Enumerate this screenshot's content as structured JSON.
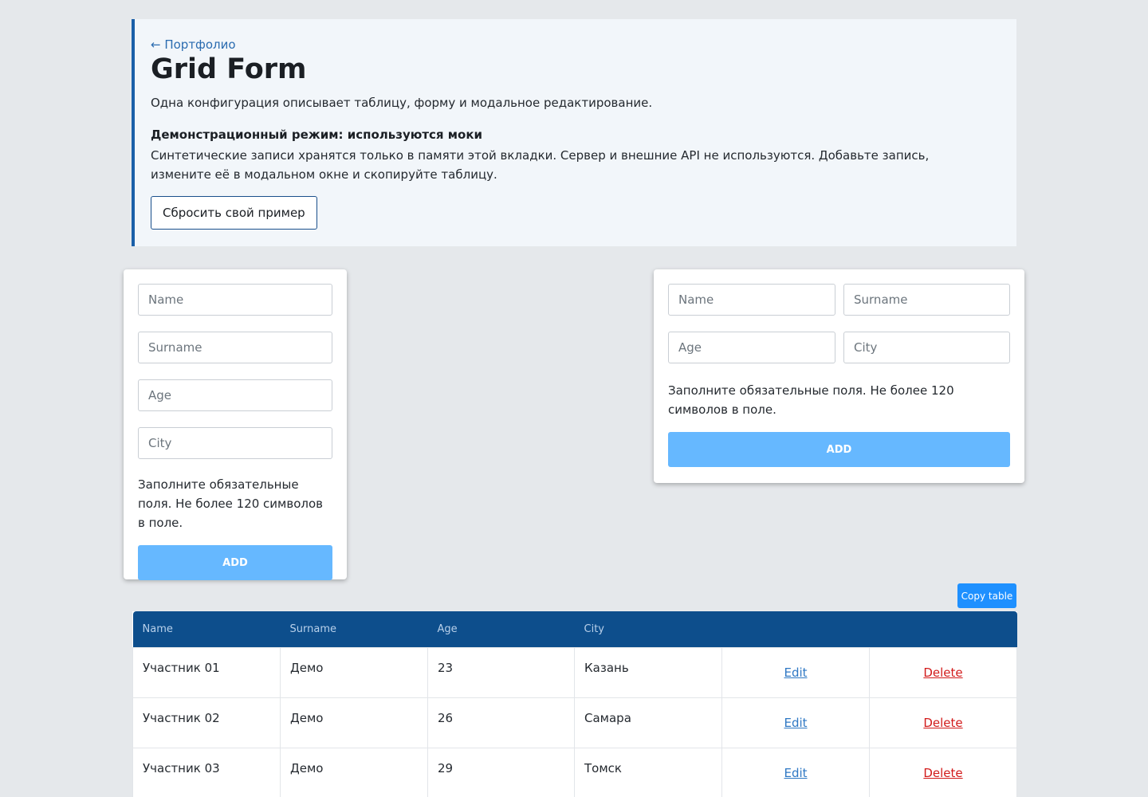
{
  "header": {
    "back_link": "← Портфолио",
    "title": "Grid Form",
    "description": "Одна конфигурация описывает таблицу, форму и модальное редактирование.",
    "demo_title": "Демонстрационный режим: используются моки",
    "demo_description": "Синтетические записи хранятся только в памяти этой вкладки. Сервер и внешние API не используются. Добавьте запись, измените её в модальном окне и скопируйте таблицу.",
    "reset_button": "Сбросить свой пример"
  },
  "form_vertical": {
    "name_placeholder": "Name",
    "surname_placeholder": "Surname",
    "age_placeholder": "Age",
    "city_placeholder": "City",
    "hint": "Заполните обязательные поля. Не более 120 символов в поле.",
    "add_button": "ADD"
  },
  "form_grid": {
    "name_placeholder": "Name",
    "surname_placeholder": "Surname",
    "age_placeholder": "Age",
    "city_placeholder": "City",
    "hint": "Заполните обязательные поля. Не более 120 символов в поле.",
    "add_button": "ADD"
  },
  "copy_button": "Copy table",
  "table": {
    "columns": [
      "Name",
      "Surname",
      "Age",
      "City"
    ],
    "rows": [
      {
        "name": "Участник 01",
        "surname": "Демо",
        "age": "23",
        "city": "Казань",
        "edit": "Edit",
        "delete": "Delete"
      },
      {
        "name": "Участник 02",
        "surname": "Демо",
        "age": "26",
        "city": "Самара",
        "edit": "Edit",
        "delete": "Delete"
      },
      {
        "name": "Участник 03",
        "surname": "Демо",
        "age": "29",
        "city": "Томск",
        "edit": "Edit",
        "delete": "Delete"
      }
    ]
  },
  "colors": {
    "background": "#e5e8eb",
    "panel_background": "#f2f6fa",
    "panel_accent": "#1a5fa8",
    "add_button": "#66b8ff",
    "copy_button": "#1e90ff",
    "table_header": "#0d4e8c",
    "edit_link": "#2f78c4",
    "delete_link": "#d21a1a"
  }
}
